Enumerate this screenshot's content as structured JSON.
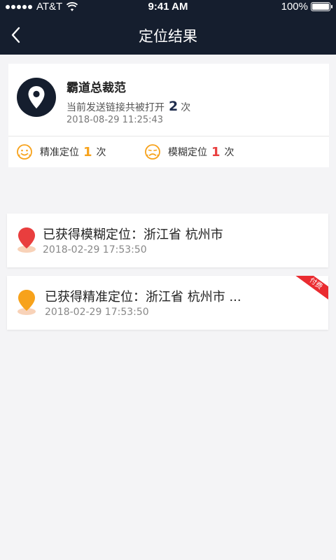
{
  "status_bar": {
    "carrier": "AT&T",
    "time": "9:41 AM",
    "battery": "100%"
  },
  "nav": {
    "title": "定位结果",
    "back_icon": "chevron-left-icon"
  },
  "profile": {
    "name": "霸道总裁范",
    "open_prefix": "当前发送链接共被打开",
    "open_count": "2",
    "open_suffix": "次",
    "time": "2018-08-29   11:25:43",
    "precise_label": "精准定位",
    "precise_count": "1",
    "fuzzy_label": "模糊定位",
    "fuzzy_count": "1",
    "times_unit": "次"
  },
  "locations": [
    {
      "title": "已获得模糊定位：浙江省 杭州市",
      "time": "2018-02-29    17:53:50",
      "pin_color": "#e93e3e"
    },
    {
      "title": "已获得精准定位：浙江省 杭州市 ...",
      "time": "2018-02-29    17:53:50",
      "pin_color": "#f7a21b",
      "ribbon": "付费"
    }
  ],
  "colors": {
    "nav_bg": "#151e2e",
    "accent_orange": "#f7a21b",
    "accent_red": "#e93e3e",
    "count_blue": "#1f2d4d"
  }
}
